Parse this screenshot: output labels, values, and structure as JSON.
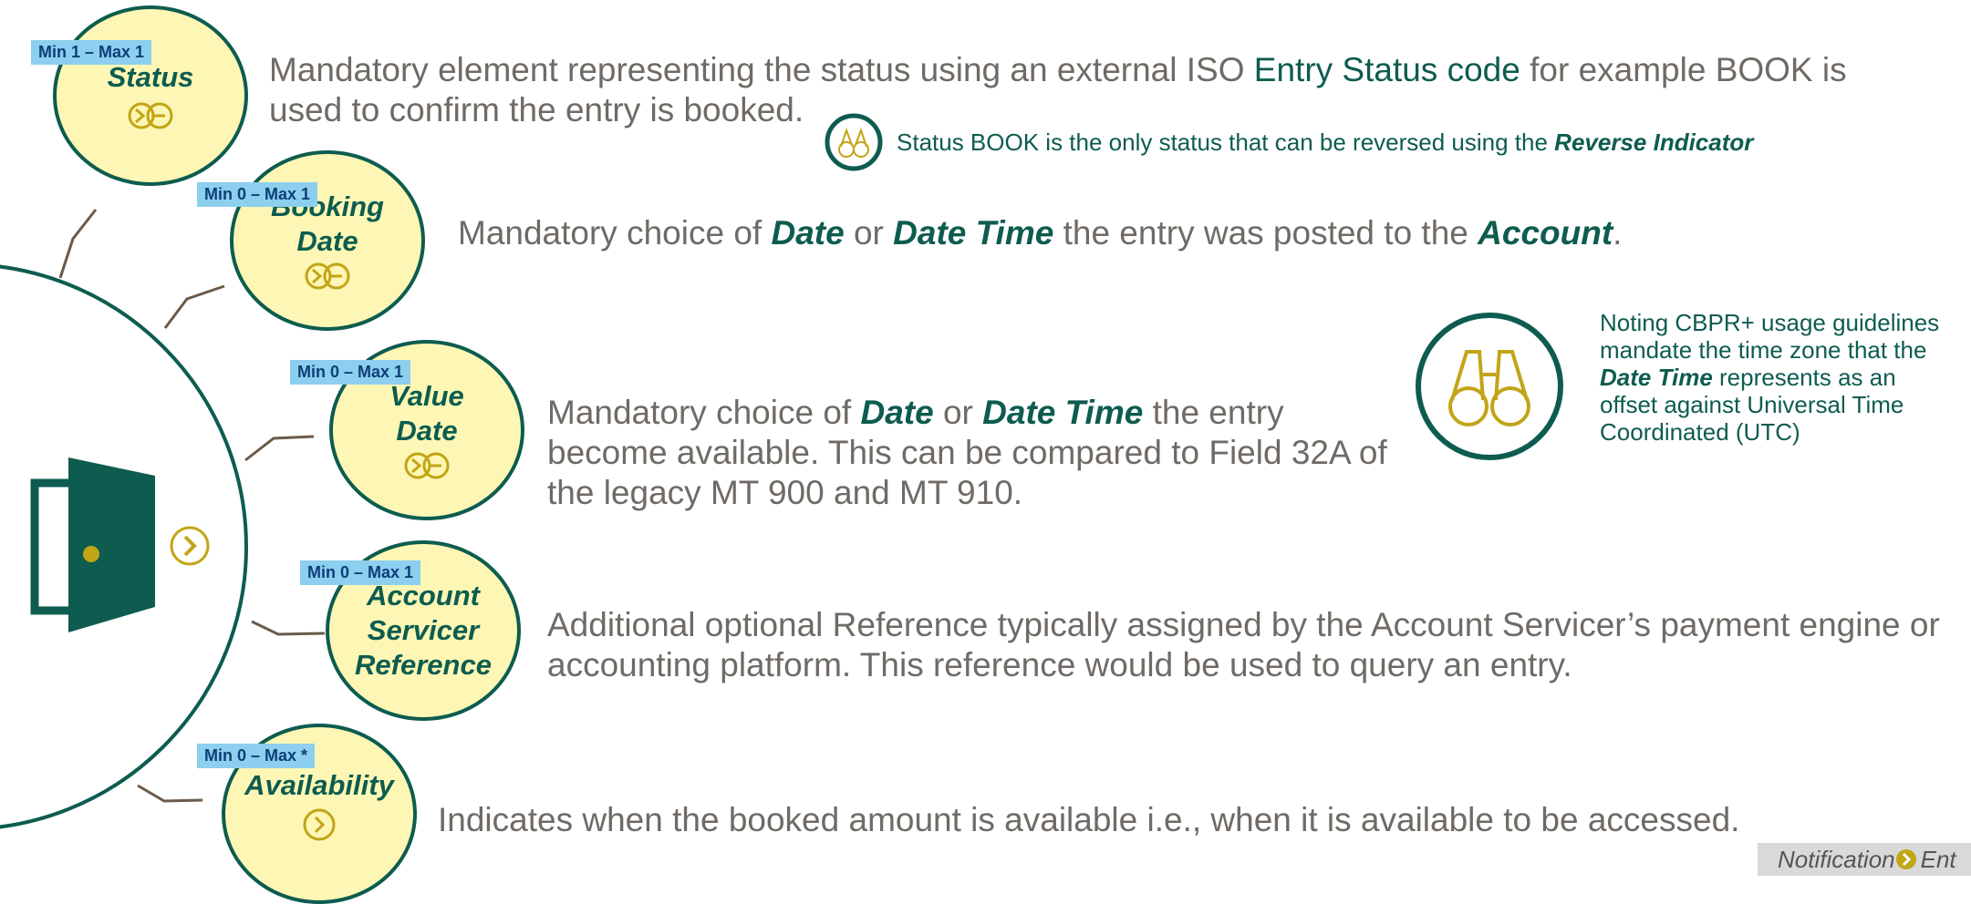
{
  "elements": [
    {
      "badge": "Min 1 – Max 1",
      "title": "Status",
      "icon": "choice-icon",
      "desc": [
        "Mandatory element representing the status using an external ISO ",
        "Entry Status code",
        " for example BOOK is used to confirm the entry is booked."
      ]
    },
    {
      "badge": "Min 0 – Max 1",
      "title_lines": [
        "Booking",
        "Date"
      ],
      "icon": "choice-icon",
      "desc": [
        "Mandatory choice of ",
        "Date",
        " or ",
        "Date Time",
        " the entry was posted to the ",
        "Account",
        "."
      ]
    },
    {
      "badge": "Min 0 – Max 1",
      "title_lines": [
        "Value",
        "Date"
      ],
      "icon": "choice-icon",
      "desc": [
        "Mandatory choice of ",
        "Date",
        " or ",
        "Date Time",
        " the entry become available. This can be compared to Field 32A of the legacy MT 900 and MT 910."
      ]
    },
    {
      "badge": "Min 0 – Max 1",
      "title_lines": [
        "Account",
        "Servicer",
        "Reference"
      ],
      "desc": "Additional optional Reference typically assigned by the Account Servicer’s payment engine or accounting platform. This reference would be used to query an entry."
    },
    {
      "badge": "Min 0 – Max *",
      "title": "Availability",
      "icon": "chevron-right-icon",
      "desc": "Indicates when the booked amount is available i.e., when it is available to be accessed."
    }
  ],
  "status_note": {
    "text": "Status BOOK is the only status that can be reversed using the ",
    "emphasis": "Reverse Indicator",
    "icon": "binoculars-icon"
  },
  "side_note": {
    "pre": "Noting CBPR+ usage guidelines mandate the time zone that the ",
    "emphasis": "Date Time",
    "post": " represents as an offset against Universal Time Coordinated (UTC)",
    "icon": "binoculars-icon"
  },
  "main_icon": {
    "name": "open-door-icon",
    "chevron": "chevron-right-icon"
  },
  "breadcrumb": {
    "part1": "Notification",
    "part2": "Ent"
  },
  "colors": {
    "primary": "#0d5c4f",
    "fill": "#fdf6b5",
    "badge": "#8ccfee",
    "gold": "#c2a516",
    "text": "#6f6a65"
  }
}
